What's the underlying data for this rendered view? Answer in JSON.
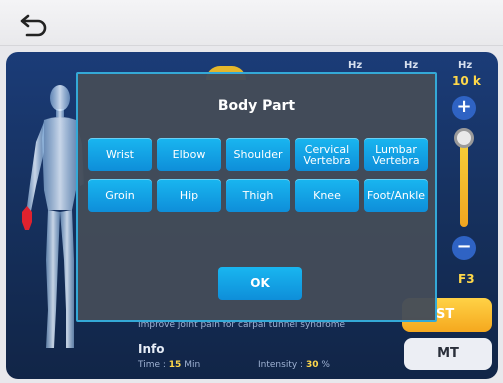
{
  "header": {
    "back_icon": "back-arrow-icon"
  },
  "frequency": {
    "hz_labels": [
      "Hz",
      "Hz",
      "Hz"
    ],
    "value": "10 k"
  },
  "slider": {
    "plus": "+",
    "minus": "−",
    "level_label": "F3"
  },
  "buttons": {
    "st_label": "ST",
    "mt_label": "MT"
  },
  "info": {
    "description": "Improve joint pain for carpal tunnel syndrome",
    "title": "Info",
    "time_label": "Time :",
    "time_value": "15",
    "time_unit": "Min",
    "intensity_label": "Intensity :",
    "intensity_value": "30",
    "intensity_unit": "%"
  },
  "dialog": {
    "title": "Body Part",
    "row1": [
      "Wrist",
      "Elbow",
      "Shoulder",
      "Cervical Vertebra",
      "Lumbar Vertebra"
    ],
    "row2": [
      "Groin",
      "Hip",
      "Thigh",
      "Knee",
      "Foot/Ankle"
    ],
    "ok_label": "OK"
  },
  "colors": {
    "accent": "#1aa8e6",
    "highlight": "#ffd84a",
    "selected_region": "#e0222e"
  }
}
